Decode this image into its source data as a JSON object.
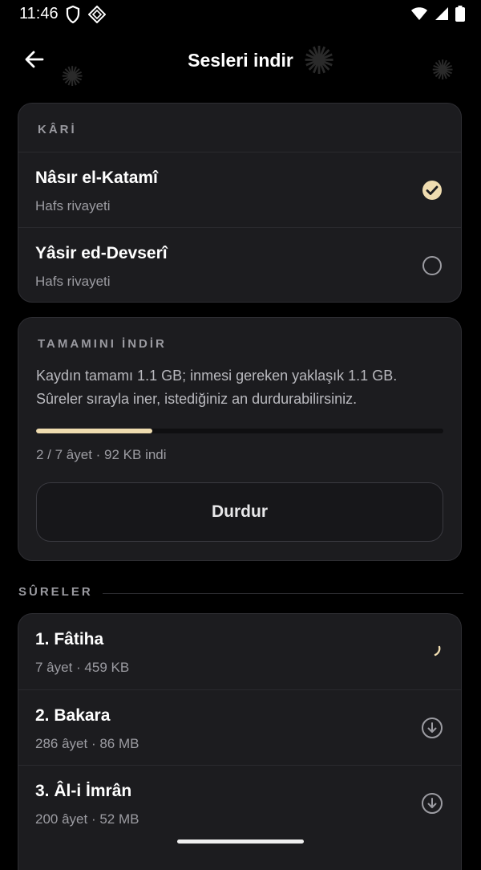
{
  "status": {
    "time": "11:46"
  },
  "header": {
    "title": "Sesleri indir"
  },
  "reciters": {
    "section_label": "KÂRİ",
    "items": [
      {
        "name": "Nâsır el-Katamî",
        "narration": "Hafs rivayeti",
        "selected": true
      },
      {
        "name": "Yâsir ed-Devserî",
        "narration": "Hafs rivayeti",
        "selected": false
      }
    ]
  },
  "download_all": {
    "section_label": "TAMAMINI İNDİR",
    "description_line1": "Kaydın tamamı 1.1 GB; inmesi gereken yaklaşık 1.1 GB.",
    "description_line2": "Sûreler sırayla iner, istediğiniz an durdurabilirsiniz.",
    "progress_fraction": 0.285,
    "progress_text": "2 / 7 âyet · 92 KB indi",
    "stop_label": "Durdur"
  },
  "surahs": {
    "section_label": "SÛRELER",
    "items": [
      {
        "title": "1. Fâtiha",
        "meta": "7 âyet · 459 KB",
        "state": "downloading"
      },
      {
        "title": "2. Bakara",
        "meta": "286 âyet · 86 MB",
        "state": "download"
      },
      {
        "title": "3. Âl-i İmrân",
        "meta": "200 âyet · 52 MB",
        "state": "download"
      }
    ]
  },
  "colors": {
    "accent": "#efdcb0",
    "card": "#1c1c1f",
    "background": "#000000"
  }
}
